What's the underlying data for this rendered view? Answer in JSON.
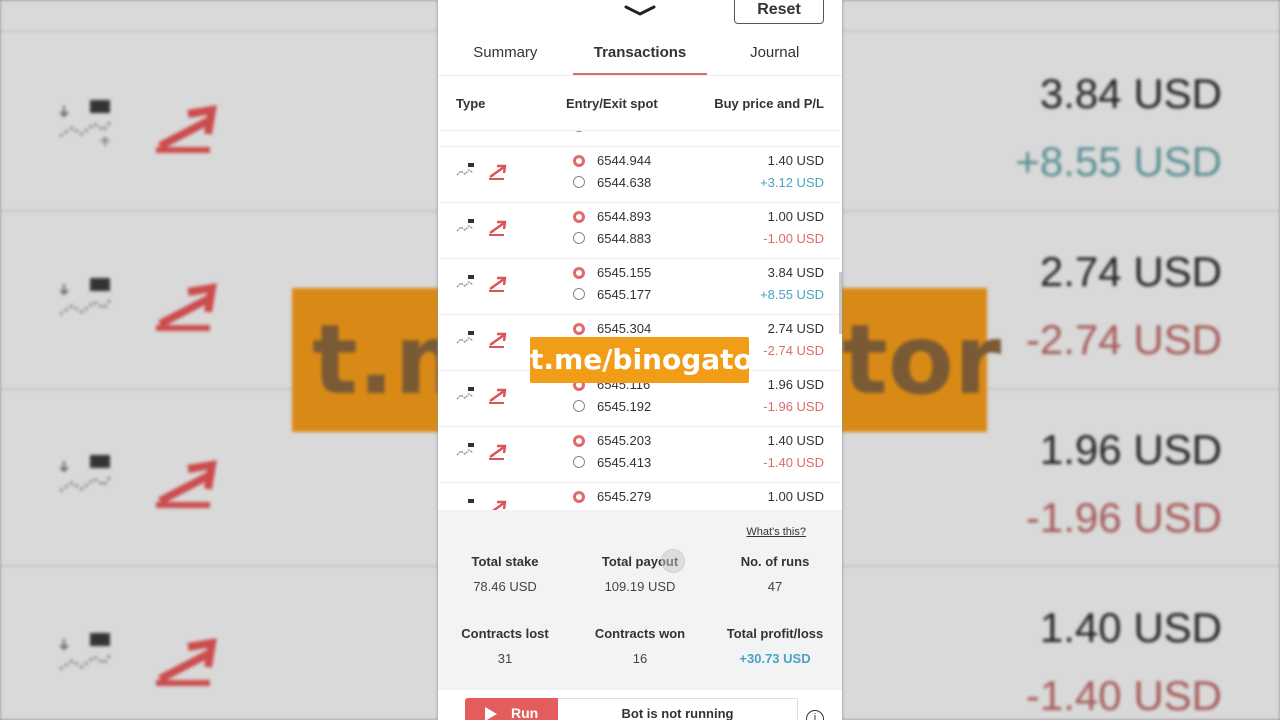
{
  "background": {
    "left_icon_rows": 4,
    "right_values": [
      {
        "text": "3.84 USD",
        "tone": "dark"
      },
      {
        "text": "+8.55 USD",
        "tone": "green"
      },
      {
        "text": "2.74 USD",
        "tone": "dark"
      },
      {
        "text": "-2.74 USD",
        "tone": "red"
      },
      {
        "text": "1.96 USD",
        "tone": "dark"
      },
      {
        "text": "-1.96 USD",
        "tone": "red"
      },
      {
        "text": "1.40 USD",
        "tone": "dark"
      },
      {
        "text": "-1.40 USD",
        "tone": "red"
      }
    ],
    "watermark_left": "t.m",
    "watermark_right": "tor"
  },
  "header": {
    "reset_label": "Reset",
    "chevron_icon": "chevron-down-icon"
  },
  "tabs": [
    {
      "label": "Summary",
      "active": false
    },
    {
      "label": "Transactions",
      "active": true
    },
    {
      "label": "Journal",
      "active": false
    }
  ],
  "table": {
    "headers": {
      "type": "Type",
      "spot": "Entry/Exit spot",
      "price": "Buy price and P/L"
    },
    "rows": [
      {
        "entry": "6544.944",
        "exit": "6544.638",
        "buy": "1.40 USD",
        "pl": "+3.12 USD",
        "pl_sign": "pos"
      },
      {
        "entry": "6544.893",
        "exit": "6544.883",
        "buy": "1.00 USD",
        "pl": "-1.00 USD",
        "pl_sign": "neg"
      },
      {
        "entry": "6545.155",
        "exit": "6545.177",
        "buy": "3.84 USD",
        "pl": "+8.55 USD",
        "pl_sign": "pos"
      },
      {
        "entry": "6545.304",
        "exit": "",
        "buy": "2.74 USD",
        "pl": "-2.74 USD",
        "pl_sign": "neg"
      },
      {
        "entry": "6545.116",
        "exit": "6545.192",
        "buy": "1.96 USD",
        "pl": "-1.96 USD",
        "pl_sign": "neg"
      },
      {
        "entry": "6545.203",
        "exit": "6545.413",
        "buy": "1.40 USD",
        "pl": "-1.40 USD",
        "pl_sign": "neg"
      },
      {
        "entry": "6545.279",
        "exit": "",
        "buy": "1.00 USD",
        "pl": "",
        "pl_sign": "neg"
      }
    ]
  },
  "summary": {
    "whats_this": "What's this?",
    "total_stake_label": "Total stake",
    "total_stake_value": "78.46 USD",
    "total_payout_label": "Total payout",
    "total_payout_value": "109.19 USD",
    "runs_label": "No. of runs",
    "runs_value": "47",
    "lost_label": "Contracts lost",
    "lost_value": "31",
    "won_label": "Contracts won",
    "won_value": "16",
    "pl_label": "Total profit/loss",
    "pl_value": "+30.73 USD"
  },
  "runbar": {
    "run_label": "Run",
    "status": "Bot is not running",
    "info_symbol": "i"
  },
  "watermark": "t.me/binogator",
  "colors": {
    "accent_red": "#e06b6b",
    "profit_blue": "#4aa3c2",
    "watermark_orange": "#f29d17"
  }
}
